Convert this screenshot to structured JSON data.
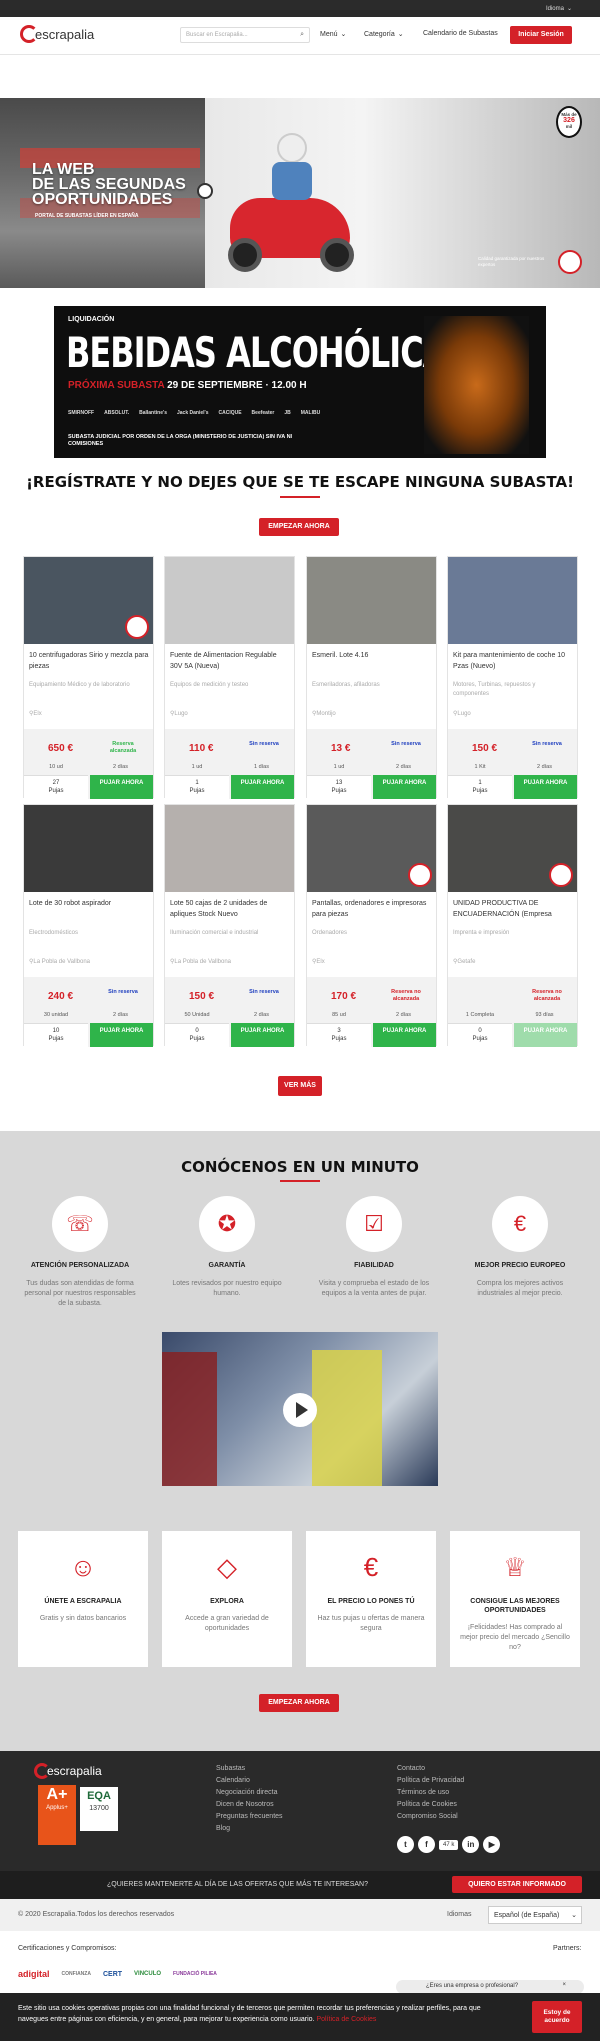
{
  "topbar": {
    "language_label": "Idioma"
  },
  "header": {
    "logo_text": "escrapalia",
    "search_placeholder": "Buscar en Escrapalia...",
    "menu_label": "Menú",
    "category_label": "Categoría",
    "calendar_label": "Calendario de Subastas",
    "login_label": "Iniciar Sesión"
  },
  "hero": {
    "title_lines": [
      "LA WEB",
      "DE LAS SEGUNDAS",
      "OPORTUNIDADES"
    ],
    "subtitle": "PORTAL DE SUBASTAS LÍDER EN ESPAÑA",
    "badge_top": "Más de",
    "badge_mid": "326",
    "badge_bottom": "mil",
    "right_caption": "Calidad garantizada por nuestros expertos"
  },
  "banner": {
    "label": "LIQUIDACIÓN",
    "title": "BEBIDAS ALCOHÓLICAS",
    "next_prefix": "PRÓXIMA SUBASTA",
    "next_date": "29 DE SEPTIEMBRE · 12.00 H",
    "note": "SUBASTA JUDICIAL POR ORDEN DE LA ORGA (MINISTERIO DE JUSTICIA) SIN IVA NI COMISIONES",
    "brands": [
      "SMIRNOFF",
      "ABSOLUT.",
      "Ballantine's",
      "Jack Daniel's",
      "CACIQUE",
      "Beefeater",
      "JB",
      "MALIBU"
    ]
  },
  "register": {
    "heading": "¡REGÍSTRATE Y NO DEJES QUE SE TE ESCAPE NINGUNA SUBASTA!",
    "cta": "EMPEZAR AHORA"
  },
  "lots": [
    {
      "title": "10 centrifugadoras Sirio y mezcla para piezas",
      "category": "Equipamiento Médico y de laboratorio",
      "location": "Elx",
      "price": "650 €",
      "reserve": "Reserva alcanzada",
      "reserve_color": "#2fb44a",
      "qty": "10 ud",
      "days": "2 días",
      "bids": "27",
      "bids_label": "Pujas",
      "bid_btn": "PUJAR AHORA",
      "img": "#4a5560",
      "badge": true
    },
    {
      "title": "Fuente de Alimentacion Regulable 30V 5A (Nueva)",
      "category": "Equipos de medición y testeo",
      "location": "Lugo",
      "price": "110 €",
      "reserve": "Sin reserva",
      "reserve_color": "#1f3fbf",
      "qty": "1 ud",
      "days": "1 días",
      "bids": "1",
      "bids_label": "Pujas",
      "bid_btn": "PUJAR AHORA",
      "img": "#c9c9c9",
      "badge": false
    },
    {
      "title": "Esmeril. Lote 4.16",
      "category": "Esmeriladoras, afiladoras",
      "location": "Montijo",
      "price": "13 €",
      "reserve": "Sin reserva",
      "reserve_color": "#1f3fbf",
      "qty": "1 ud",
      "days": "2 días",
      "bids": "13",
      "bids_label": "Pujas",
      "bid_btn": "PUJAR AHORA",
      "img": "#8a8a84",
      "badge": false
    },
    {
      "title": "Kit para mantenimiento de coche 10 Pzas (Nuevo)",
      "category": "Motores, Turbinas, repuestos y componentes",
      "location": "Lugo",
      "price": "150 €",
      "reserve": "Sin reserva",
      "reserve_color": "#1f3fbf",
      "qty": "1 Kit",
      "days": "2 días",
      "bids": "1",
      "bids_label": "Pujas",
      "bid_btn": "PUJAR AHORA",
      "img": "#6a7a96",
      "badge": false
    },
    {
      "title": "Lote de 30 robot aspirador",
      "category": "Electrodomésticos",
      "location": "La Pobla de Vallbona",
      "price": "240 €",
      "reserve": "Sin reserva",
      "reserve_color": "#1f3fbf",
      "qty": "30 unidad",
      "days": "2 días",
      "bids": "10",
      "bids_label": "Pujas",
      "bid_btn": "PUJAR AHORA",
      "img": "#3a3a3a",
      "badge": false
    },
    {
      "title": "Lote 50 cajas de 2 unidades de apliques Stock Nuevo",
      "category": "Iluminación comercial e industrial",
      "location": "La Pobla de Vallbona",
      "price": "150 €",
      "reserve": "Sin reserva",
      "reserve_color": "#1f3fbf",
      "qty": "50 Unidad",
      "days": "2 días",
      "bids": "0",
      "bids_label": "Pujas",
      "bid_btn": "PUJAR AHORA",
      "img": "#b5b0ad",
      "badge": false
    },
    {
      "title": "Pantallas, ordenadores e impresoras para piezas",
      "category": "Ordenadores",
      "location": "Elx",
      "price": "170 €",
      "reserve": "Reserva no alcanzada",
      "reserve_color": "#d42128",
      "qty": "85 ud",
      "days": "2 días",
      "bids": "3",
      "bids_label": "Pujas",
      "bid_btn": "PUJAR AHORA",
      "img": "#5a5a5a",
      "badge": true
    },
    {
      "title": "UNIDAD PRODUCTIVA DE ENCUADERNACIÓN (Empresa",
      "category": "Imprenta e impresión",
      "location": "Getafe",
      "price": "",
      "reserve": "Reserva no alcanzada",
      "reserve_color": "#d42128",
      "qty": "1 Completa",
      "days": "93 días",
      "bids": "0",
      "bids_label": "Pujas",
      "bid_btn": "PUJAR AHORA",
      "img": "#4a4a48",
      "badge": true,
      "faded": true
    }
  ],
  "see_more": "VER MÁS",
  "about": {
    "heading": "CONÓCENOS EN UN MINUTO",
    "features": [
      {
        "icon": "headset-icon",
        "glyph": "☏",
        "title": "ATENCIÓN PERSONALIZADA",
        "desc": "Tus dudas son atendidas de forma personal por nuestros responsables de la subasta."
      },
      {
        "icon": "guarantee-seal-icon",
        "glyph": "✪",
        "title": "GARANTÍA",
        "desc": "Lotes revisados por nuestro equipo humano."
      },
      {
        "icon": "box-check-icon",
        "glyph": "☑",
        "title": "FIABILIDAD",
        "desc": "Visita y comprueba el estado de los equipos a la venta antes de pujar."
      },
      {
        "icon": "euro-badge-icon",
        "glyph": "€",
        "title": "MEJOR PRECIO EUROPEO",
        "desc": "Compra los mejores activos industriales al mejor precio."
      }
    ],
    "steps": [
      {
        "icon": "user-icon",
        "glyph": "☺",
        "title": "ÚNETE A ESCRAPALIA",
        "desc": "Gratis y sin datos bancarios"
      },
      {
        "icon": "diamond-icon",
        "glyph": "◇",
        "title": "EXPLORA",
        "desc": "Accede a gran variedad de oportunidades"
      },
      {
        "icon": "euro-icon",
        "glyph": "€",
        "title": "EL PRECIO LO PONES TÚ",
        "desc": "Haz tus pujas u ofertas de manera segura"
      },
      {
        "icon": "trophy-icon",
        "glyph": "♕",
        "title": "CONSIGUE LAS MEJORES OPORTUNIDADES",
        "desc": "¡Felicidades! Has comprado al mejor precio del mercado ¿Sencillo no?"
      }
    ],
    "cta": "EMPEZAR AHORA"
  },
  "footer": {
    "logo_text": "escrapalia",
    "col1": [
      "Subastas",
      "Calendario",
      "Negociación directa",
      "Dicen de Nosotros",
      "Preguntas frecuentes",
      "Blog"
    ],
    "col2": [
      "Contacto",
      "Política de Privacidad",
      "Términos de uso",
      "Política de Cookies",
      "Compromiso Social"
    ],
    "social_count": "47 k",
    "cert_a": "A+",
    "cert_a_sub": "Applus+",
    "cert_eqa": "EQA",
    "cert_eqa_num": "13700"
  },
  "newsletter": {
    "text": "¿QUIERES MANTENERTE AL DÍA DE LAS OFERTAS QUE MÁS TE INTERESAN?",
    "cta": "QUIERO ESTAR INFORMADO"
  },
  "copyright": {
    "text": "© 2020 Escrapalia.Todos los derechos reservados",
    "lang_label": "Idiomas",
    "lang_value": "Español (de España)"
  },
  "certs": {
    "label": "Certificaciones y Compromisos:",
    "partners_label": "Partners:",
    "logos": [
      "adigital",
      "CONFIANZA",
      "CERT",
      "VINCULO",
      "FUNDACIÓ PILIEA"
    ]
  },
  "business_bubble": "¿Eres una empresa o profesional?",
  "cookie": {
    "text": "Este sitio usa cookies operativas propias con una finalidad funcional y de terceros que permiten recordar tus preferencias y realizar perfiles, para que navegues entre páginas con eficiencia, y en general, para mejorar tu experiencia como usuario.",
    "link": "Política de Cookies",
    "accept": "Estoy de acuerdo"
  }
}
